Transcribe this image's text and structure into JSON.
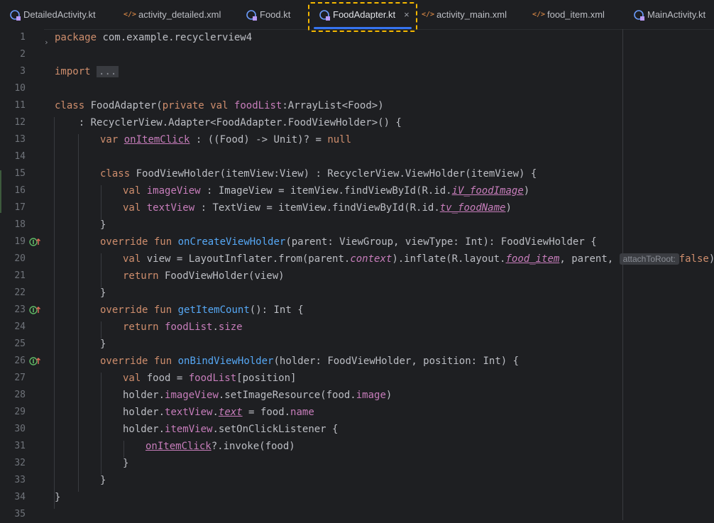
{
  "tabs": [
    {
      "label": "DetailedActivity.kt",
      "icon": "kotlin-class-icon",
      "active": false
    },
    {
      "label": "activity_detailed.xml",
      "icon": "xml-file-icon",
      "active": false
    },
    {
      "label": "Food.kt",
      "icon": "kotlin-class-icon",
      "active": false
    },
    {
      "label": "FoodAdapter.kt",
      "icon": "kotlin-class-icon",
      "active": true,
      "close": "×"
    },
    {
      "label": "activity_main.xml",
      "icon": "xml-file-icon",
      "active": false
    },
    {
      "label": "food_item.xml",
      "icon": "xml-file-icon",
      "active": false
    },
    {
      "label": "MainActivity.kt",
      "icon": "kotlin-class-icon",
      "active": false
    }
  ],
  "editor": {
    "line_numbers": [
      "1",
      "2",
      "3",
      "10",
      "11",
      "12",
      "13",
      "14",
      "15",
      "16",
      "17",
      "18",
      "19",
      "20",
      "21",
      "22",
      "23",
      "24",
      "25",
      "26",
      "27",
      "28",
      "29",
      "30",
      "31",
      "32",
      "33",
      "34",
      "35"
    ],
    "code": {
      "l1": [
        "package",
        " com.example.recyclerview4"
      ],
      "l3": [
        "import",
        "..."
      ],
      "l11": [
        "class",
        " FoodAdapter(",
        "private",
        " ",
        "val",
        " ",
        "foodList",
        ":ArrayList<Food>)"
      ],
      "l12": [
        "    : RecyclerView.Adapter<FoodAdapter.FoodViewHolder>() {"
      ],
      "l13": [
        "var",
        " ",
        "onItemClick",
        " : ((Food) -> Unit)? = ",
        "null"
      ],
      "l15": [
        "class",
        " FoodViewHolder(itemView:View) : RecyclerView.ViewHolder(itemView) {"
      ],
      "l16": [
        "val",
        " ",
        "imageView",
        " : ImageView = itemView.findViewById(R.id.",
        "iV_foodImage",
        ")"
      ],
      "l17": [
        "val",
        " ",
        "textView",
        " : TextView = itemView.findViewById(R.id.",
        "tv_foodName",
        ")"
      ],
      "l18": [
        "}"
      ],
      "l19": [
        "override",
        " ",
        "fun",
        " ",
        "onCreateViewHolder",
        "(parent: ViewGroup, viewType: Int): FoodViewHolder {"
      ],
      "l20": [
        "val",
        " view = LayoutInflater.from(parent.",
        "context",
        ").inflate(R.layout.",
        "food_item",
        ", parent, ",
        "attachToRoot:",
        "false",
        ")"
      ],
      "l21": [
        "return",
        " FoodViewHolder(view)"
      ],
      "l22": [
        "}"
      ],
      "l23": [
        "override",
        " ",
        "fun",
        " ",
        "getItemCount",
        "(): Int {"
      ],
      "l24": [
        "return",
        " ",
        "foodList",
        ".",
        "size"
      ],
      "l25": [
        "}"
      ],
      "l26": [
        "override",
        " ",
        "fun",
        " ",
        "onBindViewHolder",
        "(holder: FoodViewHolder, position: Int) {"
      ],
      "l27": [
        "val",
        " food = ",
        "foodList",
        "[position]"
      ],
      "l28": [
        "holder.",
        "imageView",
        ".setImageResource(food.",
        "image",
        ")"
      ],
      "l29": [
        "holder.",
        "textView",
        ".",
        "text",
        " = food.",
        "name"
      ],
      "l30": [
        "holder.",
        "itemView",
        ".setOnClickListener {"
      ],
      "l31": [
        "onItemClick",
        "?.invoke(food)"
      ],
      "l32": [
        "}"
      ],
      "l33": [
        "}"
      ],
      "l34": [
        "}"
      ]
    }
  },
  "colors": {
    "keyword": "#cf8e6d",
    "function": "#56a8f5",
    "property": "#c77dbb",
    "text": "#bcbec4",
    "accent": "#3574f0",
    "focus": "#f5b800"
  },
  "gutter_icons": [
    "override-implements-icon",
    "override-implements-icon",
    "override-implements-icon"
  ]
}
